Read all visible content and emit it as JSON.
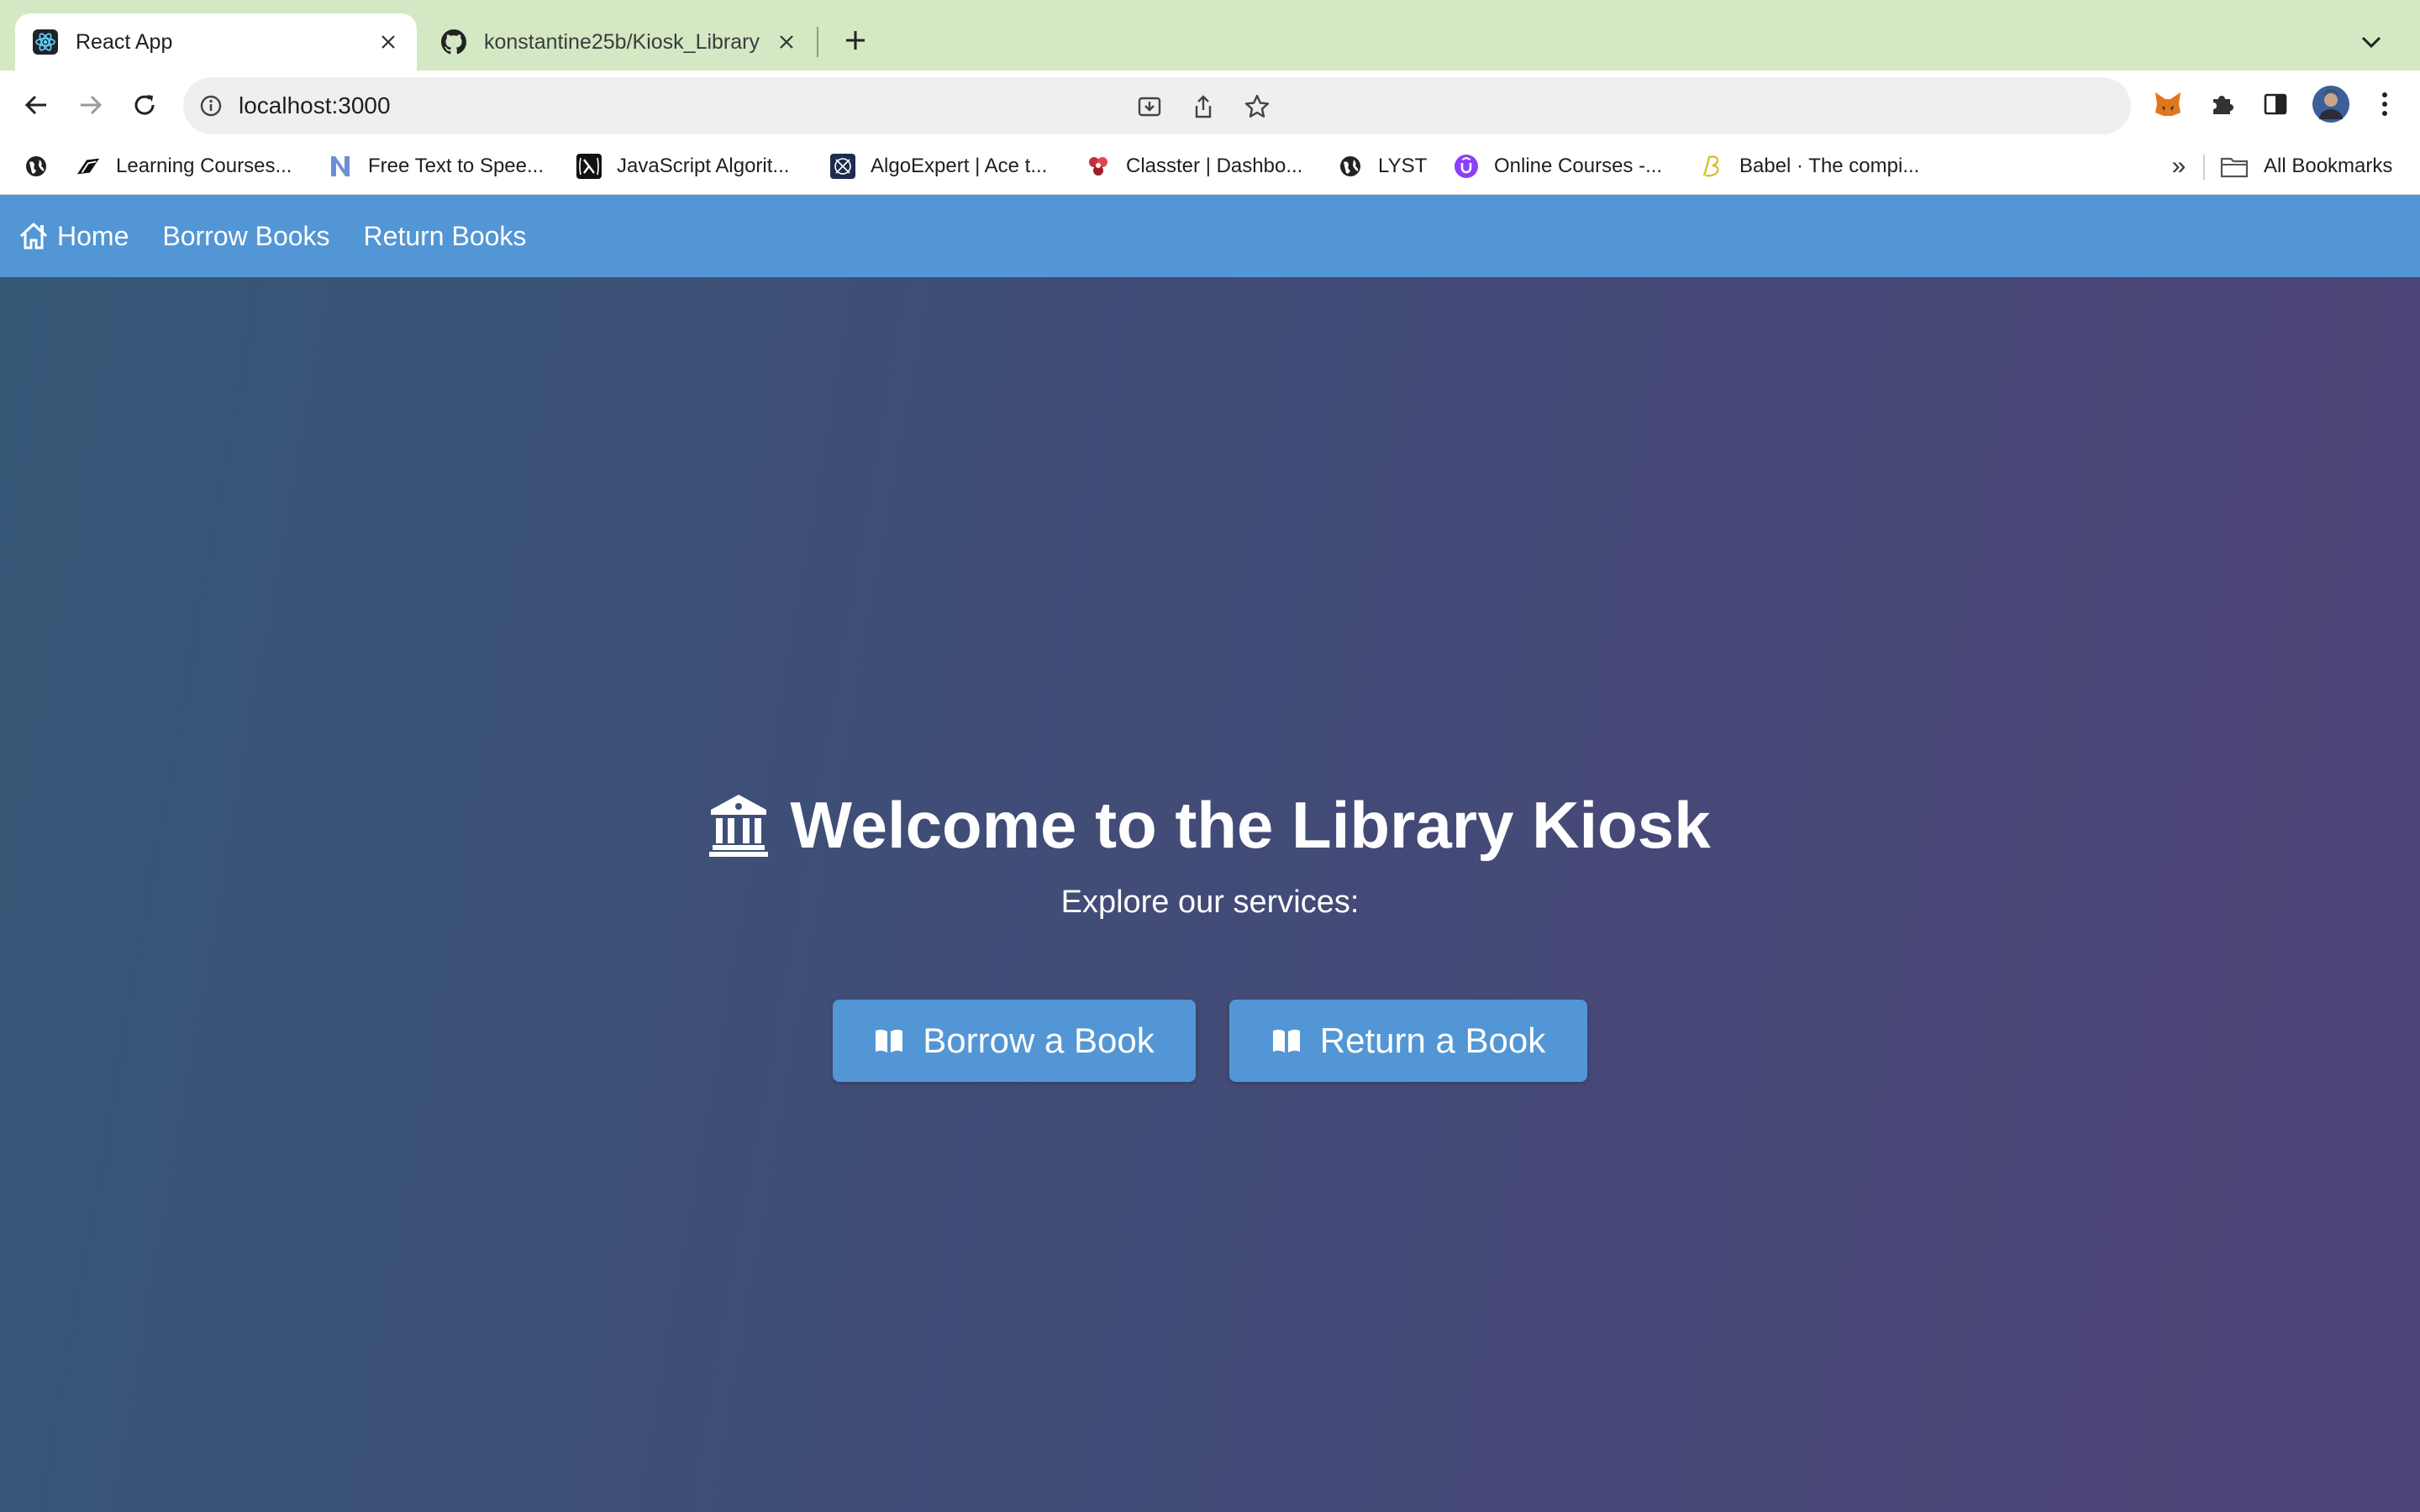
{
  "browser": {
    "tabs": [
      {
        "title": "React App",
        "icon": "react-icon",
        "active": true
      },
      {
        "title": "konstantine25b/Kiosk_Library",
        "icon": "github-icon",
        "active": false
      }
    ],
    "address": {
      "url": "localhost:3000"
    },
    "bookmarks": [
      {
        "label": "",
        "icon": "globe-icon"
      },
      {
        "label": "Learning Courses...",
        "icon": "learning-icon"
      },
      {
        "label": "Free Text to Spee...",
        "icon": "n-logo-icon"
      },
      {
        "label": "JavaScript Algorit...",
        "icon": "lambda-icon"
      },
      {
        "label": "AlgoExpert | Ace t...",
        "icon": "algoexpert-icon"
      },
      {
        "label": "Classter | Dashbo...",
        "icon": "classter-icon"
      },
      {
        "label": "LYST",
        "icon": "globe-icon"
      },
      {
        "label": "Online Courses -...",
        "icon": "udemy-icon"
      },
      {
        "label": "Babel · The compi...",
        "icon": "babel-icon"
      }
    ],
    "bookmarks_overflow": "»",
    "all_bookmarks": "All Bookmarks"
  },
  "app": {
    "nav": {
      "home": "Home",
      "borrow": "Borrow Books",
      "return": "Return Books"
    },
    "hero": {
      "title": "Welcome to the Library Kiosk",
      "subtitle": "Explore our services:",
      "borrow_button": "Borrow a Book",
      "return_button": "Return a Book"
    }
  },
  "colors": {
    "accent": "#5396d5",
    "gradient_start": "#365877",
    "gradient_end": "#4e4477",
    "tabbar": "#d3e8c3"
  }
}
